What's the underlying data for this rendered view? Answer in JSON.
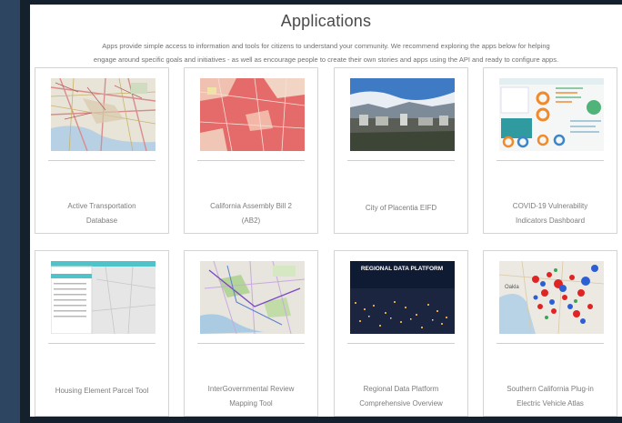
{
  "header": {
    "title": "Applications",
    "intro_line1": "Apps provide simple access to information and tools for citizens to understand your community. We recommend exploring the apps below for helping",
    "intro_line2": "engage around specific goals and initiatives - as well as encourage people to create their own stories and apps using the API and ready to configure apps."
  },
  "apps": [
    {
      "title_line1": "Active Transportation",
      "title_line2": "Database",
      "thumb": "los-angeles-street-map"
    },
    {
      "title_line1": "California Assembly Bill 2",
      "title_line2": "(AB2)",
      "thumb": "red-parcel-map"
    },
    {
      "title_line1": "City of Placentia EIFD",
      "title_line2": "",
      "thumb": "city-skyline-photo"
    },
    {
      "title_line1": "COVID-19 Vulnerability",
      "title_line2": "Indicators Dashboard",
      "thumb": "dashboard-with-donut-charts"
    },
    {
      "title_line1": "Housing Element Parcel Tool",
      "title_line2": "",
      "thumb": "parcel-tool-sidebar-map"
    },
    {
      "title_line1": "InterGovernmental Review",
      "title_line2": "Mapping Tool",
      "thumb": "regional-review-map"
    },
    {
      "title_line1": "Regional Data Platform",
      "title_line2": "Comprehensive Overview",
      "thumb": "night-city-lights-photo",
      "thumb_text": "REGIONAL DATA PLATFORM"
    },
    {
      "title_line1": "Southern California Plug-in",
      "title_line2": "Electric Vehicle Atlas",
      "thumb": "ev-charger-dot-map",
      "thumb_text": "Oakla"
    }
  ]
}
